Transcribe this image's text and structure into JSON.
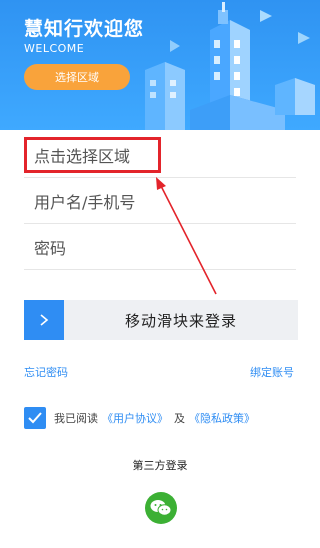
{
  "header": {
    "title": "慧知行欢迎您",
    "subtitle": "WELCOME",
    "region_button": "选择区域"
  },
  "form": {
    "region_placeholder": "点击选择区域",
    "username_placeholder": "用户名/手机号",
    "password_placeholder": "密码"
  },
  "slider": {
    "knob_icon": "chevron-right-icon",
    "label": "移动滑块来登录"
  },
  "links": {
    "forgot_password": "忘记密码",
    "bind_account": "绑定账号"
  },
  "agreement": {
    "checked": true,
    "prefix": "我已阅读",
    "user_agreement": "《用户协议》",
    "and": "及",
    "privacy_policy": "《隐私政策》"
  },
  "third_party": {
    "title": "第三方登录",
    "wechat_icon": "wechat-icon"
  },
  "colors": {
    "header": "#3fa9ff",
    "accent": "#2f8df3",
    "region_button": "#f9a33b",
    "highlight": "#e3242b",
    "wechat": "#3cb034"
  }
}
